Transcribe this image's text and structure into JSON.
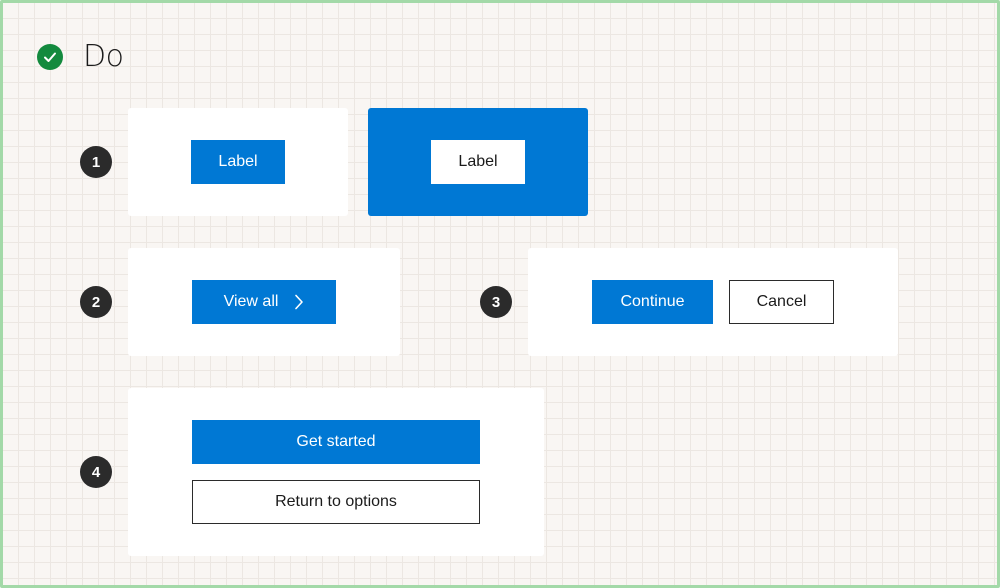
{
  "header": {
    "status_icon": "check-circle-icon",
    "title": "Do"
  },
  "colors": {
    "accent": "#0078d4",
    "success": "#138a3e",
    "badge": "#2b2b2b"
  },
  "examples": [
    {
      "number": "1",
      "buttons": [
        "Label",
        "Label"
      ]
    },
    {
      "number": "2",
      "buttons": [
        "View all"
      ],
      "icon": "chevron-right-icon"
    },
    {
      "number": "3",
      "buttons": [
        "Continue",
        "Cancel"
      ]
    },
    {
      "number": "4",
      "buttons": [
        "Get started",
        "Return to options"
      ]
    }
  ]
}
